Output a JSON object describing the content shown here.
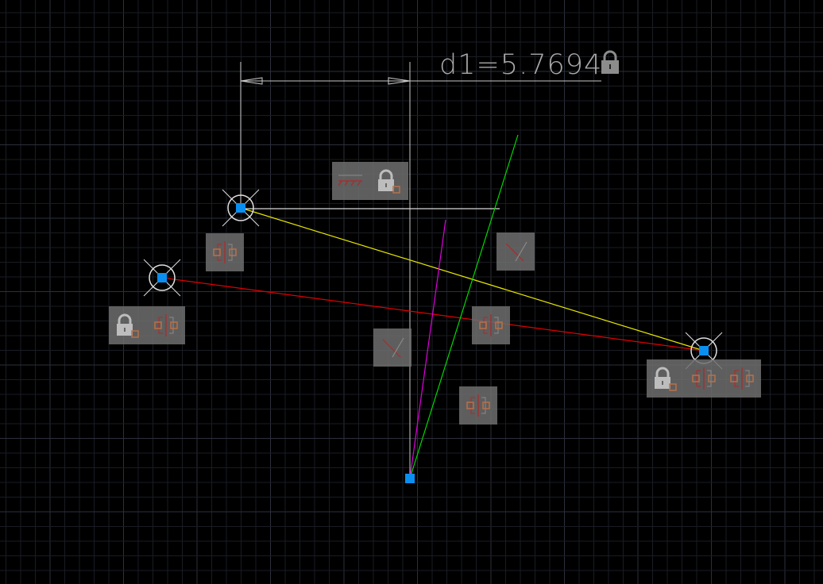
{
  "dimension": {
    "label": "d1=5.7694",
    "locked": true
  },
  "colors": {
    "background": "#000000",
    "grid_minor": "#1a1c24",
    "grid_major": "#2c2f3a",
    "grip": "#0a8ff0",
    "dimension": "#c8c8c8",
    "yellow_line": "#e6e600",
    "red_line": "#e00000",
    "magenta_line": "#e000e0",
    "green_line": "#00d800",
    "constraint_box": "#6e6e6e",
    "constraint_glyph": "#c0603a"
  },
  "constraint_bars": [
    {
      "icons": [
        "horizontal-constraint-icon",
        "lock-icon"
      ]
    },
    {
      "icons": [
        "symmetric-constraint-icon"
      ]
    },
    {
      "icons": [
        "perpendicular-constraint-icon"
      ]
    },
    {
      "icons": [
        "lock-icon",
        "symmetric-constraint-icon"
      ]
    },
    {
      "icons": [
        "symmetric-constraint-icon"
      ]
    },
    {
      "icons": [
        "perpendicular-constraint-icon"
      ]
    },
    {
      "icons": [
        "symmetric-constraint-icon"
      ]
    },
    {
      "icons": [
        "lock-icon",
        "symmetric-constraint-icon",
        "symmetric-constraint-icon"
      ]
    }
  ]
}
